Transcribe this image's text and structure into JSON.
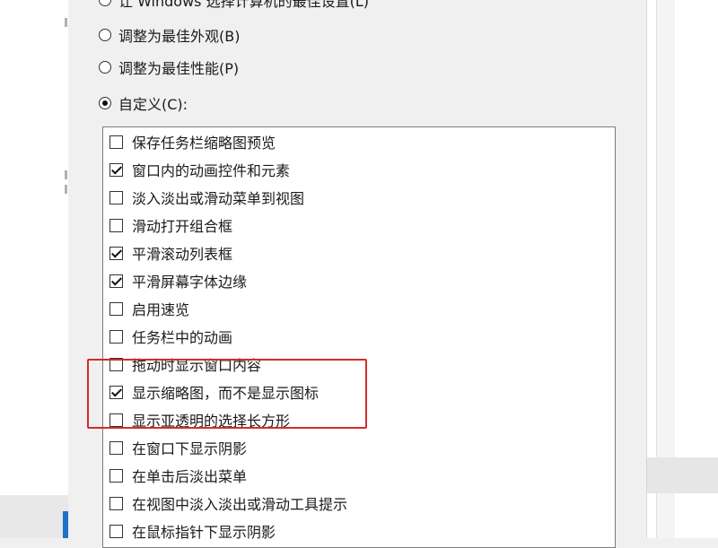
{
  "radio_options": [
    {
      "label": "让 Windows 选择计算机的最佳设置(L)",
      "checked": false
    },
    {
      "label": "调整为最佳外观(B)",
      "checked": false
    },
    {
      "label": "调整为最佳性能(P)",
      "checked": false
    },
    {
      "label": "自定义(C):",
      "checked": true
    }
  ],
  "effects": [
    {
      "label": "保存任务栏缩略图预览",
      "checked": false
    },
    {
      "label": "窗口内的动画控件和元素",
      "checked": true
    },
    {
      "label": "淡入淡出或滑动菜单到视图",
      "checked": false
    },
    {
      "label": "滑动打开组合框",
      "checked": false
    },
    {
      "label": "平滑滚动列表框",
      "checked": true
    },
    {
      "label": "平滑屏幕字体边缘",
      "checked": true
    },
    {
      "label": "启用速览",
      "checked": false
    },
    {
      "label": "任务栏中的动画",
      "checked": false
    },
    {
      "label": "拖动时显示窗口内容",
      "checked": false
    },
    {
      "label": "显示缩略图，而不是显示图标",
      "checked": true
    },
    {
      "label": "显示亚透明的选择长方形",
      "checked": false
    },
    {
      "label": "在窗口下显示阴影",
      "checked": false
    },
    {
      "label": "在单击后淡出菜单",
      "checked": false
    },
    {
      "label": "在视图中淡入淡出或滑动工具提示",
      "checked": false
    },
    {
      "label": "在鼠标指针下显示阴影",
      "checked": false
    }
  ],
  "colors": {
    "highlight": "#d42b2b",
    "accent": "#1e72c8"
  }
}
